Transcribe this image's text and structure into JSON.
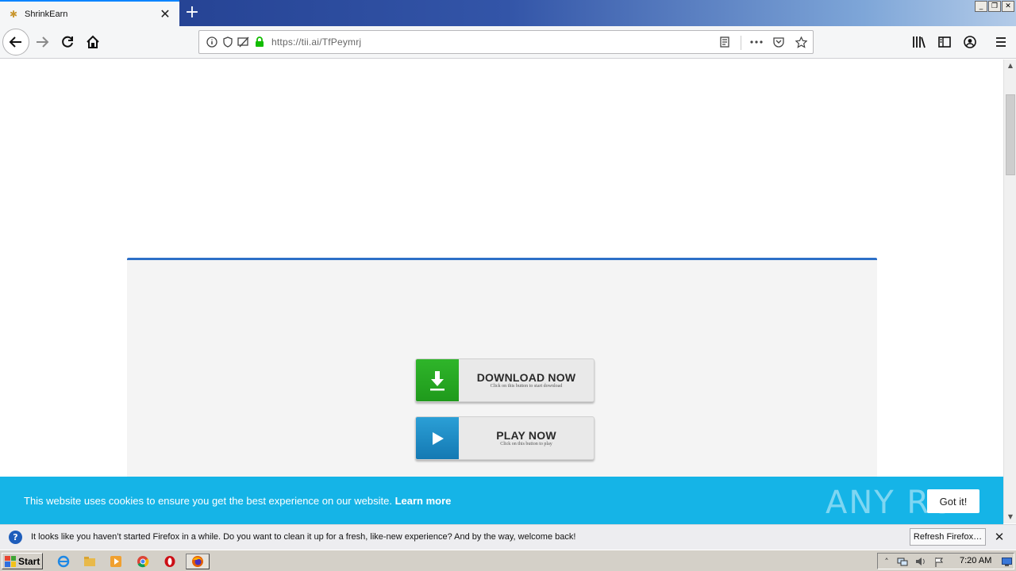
{
  "browser": {
    "tab_title": "ShrinkEarn",
    "new_tab_symbol": "+",
    "url": "https://tii.ai/TfPeymrj"
  },
  "page": {
    "download_button": {
      "title": "DOWNLOAD NOW",
      "subtitle": "Click on this button to start download"
    },
    "play_button": {
      "title": "PLAY NOW",
      "subtitle": "Click on this button to play"
    },
    "cookie": {
      "text": "This website uses cookies to ensure you get the best experience on our website.",
      "link": "Learn more",
      "accept": "Got it!"
    },
    "watermark": "ANY RUN"
  },
  "notification": {
    "text": "It looks like you haven’t started Firefox in a while. Do you want to clean it up for a fresh, like-new experience? And by the way, welcome back!",
    "button": "Refresh Firefox…"
  },
  "taskbar": {
    "start_label": "Start",
    "clock": "7:20 AM"
  },
  "colors": {
    "accent_blue": "#2d6fc7",
    "download_green": "#2fb52a",
    "play_blue": "#2b9fd6",
    "cookie_bar": "#15b4e7"
  }
}
